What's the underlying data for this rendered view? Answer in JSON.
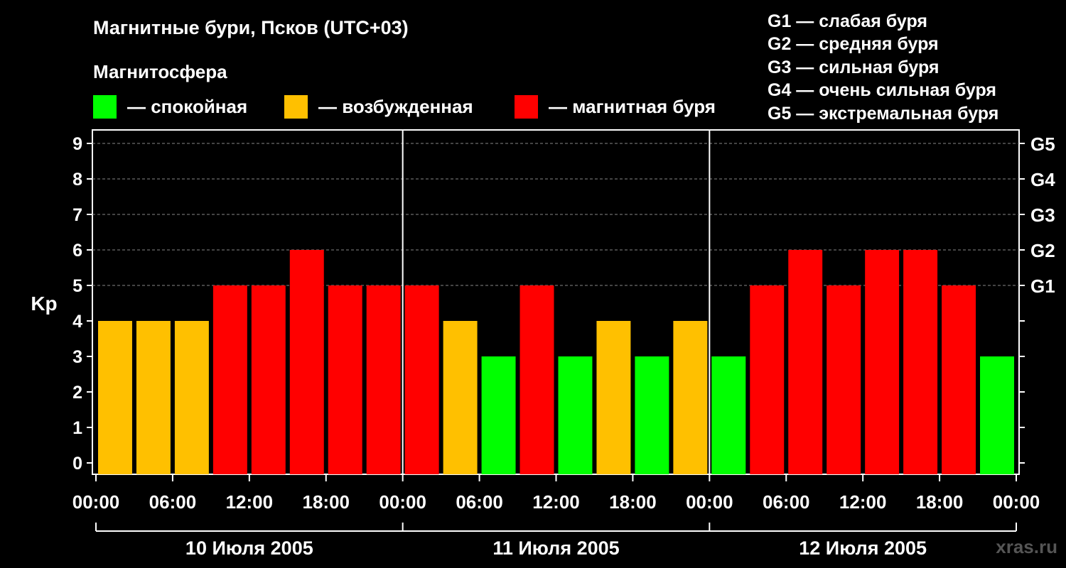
{
  "chart_data": {
    "type": "bar",
    "title": "Магнитные бури, Псков (UTC+03)",
    "subtitle": "Магнитосфера",
    "ylabel": "Kp",
    "ylim": [
      0,
      9
    ],
    "yticks": [
      "0",
      "1",
      "2",
      "3",
      "4",
      "5",
      "6",
      "7",
      "8",
      "9"
    ],
    "right_ticks": [
      {
        "value": 5,
        "label": "G1"
      },
      {
        "value": 6,
        "label": "G2"
      },
      {
        "value": 7,
        "label": "G3"
      },
      {
        "value": 8,
        "label": "G4"
      },
      {
        "value": 9,
        "label": "G5"
      }
    ],
    "xtick_labels": [
      "00:00",
      "06:00",
      "12:00",
      "18:00",
      "00:00",
      "06:00",
      "12:00",
      "18:00",
      "00:00",
      "06:00",
      "12:00",
      "18:00",
      "00:00"
    ],
    "days": [
      "10 Июля 2005",
      "11 Июля 2005",
      "12 Июля 2005"
    ],
    "categories": [
      "10 Июля 00:00",
      "10 Июля 03:00",
      "10 Июля 06:00",
      "10 Июля 09:00",
      "10 Июля 12:00",
      "10 Июля 15:00",
      "10 Июля 18:00",
      "10 Июля 21:00",
      "11 Июля 00:00",
      "11 Июля 03:00",
      "11 Июля 06:00",
      "11 Июля 09:00",
      "11 Июля 12:00",
      "11 Июля 15:00",
      "11 Июля 18:00",
      "11 Июля 21:00",
      "12 Июля 00:00",
      "12 Июля 03:00",
      "12 Июля 06:00",
      "12 Июля 09:00",
      "12 Июля 12:00",
      "12 Июля 15:00",
      "12 Июля 18:00",
      "12 Июля 21:00"
    ],
    "values": [
      4,
      4,
      4,
      5,
      5,
      6,
      5,
      5,
      5,
      4,
      3,
      5,
      3,
      4,
      3,
      4,
      3,
      5,
      6,
      5,
      6,
      6,
      5,
      3
    ],
    "legend": [
      {
        "label": "— спокойная",
        "color": "#00ff00"
      },
      {
        "label": "— возбужденная",
        "color": "#ffc000"
      },
      {
        "label": "— магнитная буря",
        "color": "#ff0000"
      }
    ],
    "grid": true,
    "colors": {
      "quiet": "#00ff00",
      "excited": "#ffc000",
      "storm": "#ff0000",
      "background": "#000000"
    }
  },
  "storm_scale": [
    "G1 — слабая буря",
    "G2 — средняя буря",
    "G3 — сильная буря",
    "G4 — очень сильная буря",
    "G5 — экстремальная буря"
  ],
  "footer": "xras.ru"
}
